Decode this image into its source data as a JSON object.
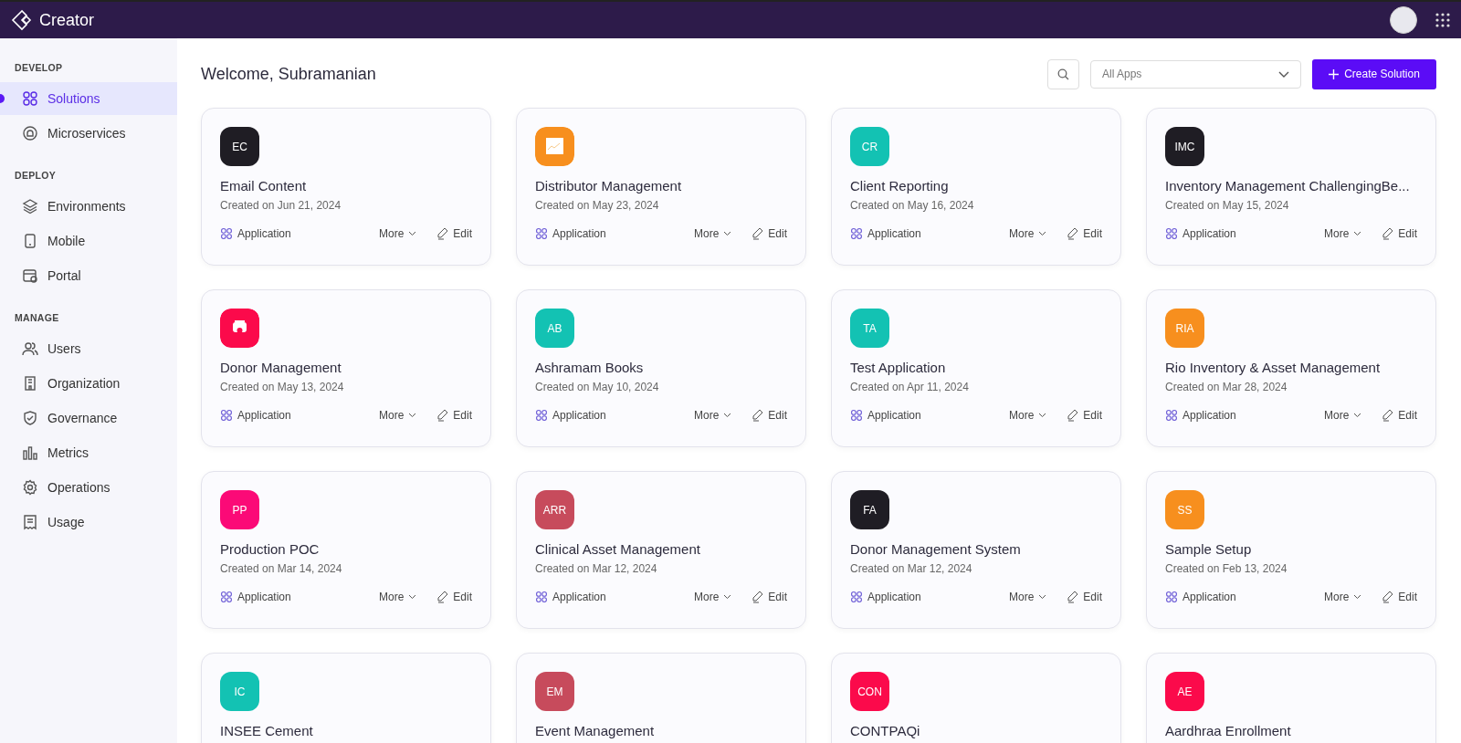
{
  "app": {
    "name": "Creator"
  },
  "sidebar": {
    "sections": [
      {
        "heading": "DEVELOP",
        "items": [
          {
            "label": "Solutions",
            "kind": "grid",
            "selected": true
          },
          {
            "label": "Microservices",
            "kind": "service",
            "selected": false
          }
        ]
      },
      {
        "heading": "DEPLOY",
        "items": [
          {
            "label": "Environments",
            "kind": "layers",
            "selected": false
          },
          {
            "label": "Mobile",
            "kind": "mobile",
            "selected": false
          },
          {
            "label": "Portal",
            "kind": "portal",
            "selected": false
          }
        ]
      },
      {
        "heading": "MANAGE",
        "items": [
          {
            "label": "Users",
            "kind": "users",
            "selected": false
          },
          {
            "label": "Organization",
            "kind": "building",
            "selected": false
          },
          {
            "label": "Governance",
            "kind": "shield",
            "selected": false
          },
          {
            "label": "Metrics",
            "kind": "bars",
            "selected": false
          },
          {
            "label": "Operations",
            "kind": "gear",
            "selected": false
          },
          {
            "label": "Usage",
            "kind": "receipt",
            "selected": false
          }
        ]
      }
    ]
  },
  "header": {
    "welcome": "Welcome, Subramanian",
    "filter": {
      "value": "All Apps"
    },
    "create_button": "Create Solution"
  },
  "cards": [
    {
      "kind": "initials",
      "badge": "EC",
      "color": "#1f1d24",
      "title": "Email Content",
      "date": "Created on Jun 21, 2024",
      "type": "Application",
      "more": "More",
      "edit": "Edit"
    },
    {
      "kind": "chart",
      "color": "#f78f1e",
      "title": "Distributor Management",
      "date": "Created on May 23, 2024",
      "type": "Application",
      "more": "More",
      "edit": "Edit"
    },
    {
      "kind": "initials",
      "badge": "CR",
      "color": "#13c2b3",
      "title": "Client Reporting",
      "date": "Created on May 16, 2024",
      "type": "Application",
      "more": "More",
      "edit": "Edit"
    },
    {
      "kind": "initials",
      "badge": "IMC",
      "color": "#1f1d24",
      "title": "Inventory Management ChallengingBe...",
      "date": "Created on May 15, 2024",
      "type": "Application",
      "more": "More",
      "edit": "Edit"
    },
    {
      "kind": "robot",
      "color": "#fb0a4b",
      "title": "Donor Management",
      "date": "Created on May 13, 2024",
      "type": "Application",
      "more": "More",
      "edit": "Edit"
    },
    {
      "kind": "initials",
      "badge": "AB",
      "color": "#13c2b3",
      "title": "Ashramam Books",
      "date": "Created on May 10, 2024",
      "type": "Application",
      "more": "More",
      "edit": "Edit"
    },
    {
      "kind": "initials",
      "badge": "TA",
      "color": "#13c2b3",
      "title": "Test Application",
      "date": "Created on Apr 11, 2024",
      "type": "Application",
      "more": "More",
      "edit": "Edit"
    },
    {
      "kind": "initials",
      "badge": "RIA",
      "color": "#f78f1e",
      "title": "Rio Inventory & Asset Management",
      "date": "Created on Mar 28, 2024",
      "type": "Application",
      "more": "More",
      "edit": "Edit"
    },
    {
      "kind": "initials",
      "badge": "PP",
      "color": "#fb0a77",
      "title": "Production POC",
      "date": "Created on Mar 14, 2024",
      "type": "Application",
      "more": "More",
      "edit": "Edit"
    },
    {
      "kind": "initials",
      "badge": "ARR",
      "color": "#c74b5c",
      "title": "Clinical Asset Management",
      "date": "Created on Mar 12, 2024",
      "type": "Application",
      "more": "More",
      "edit": "Edit"
    },
    {
      "kind": "initials",
      "badge": "FA",
      "color": "#1f1d24",
      "title": "Donor Management System",
      "date": "Created on Mar 12, 2024",
      "type": "Application",
      "more": "More",
      "edit": "Edit"
    },
    {
      "kind": "initials",
      "badge": "SS",
      "color": "#f78f1e",
      "title": "Sample Setup",
      "date": "Created on Feb 13, 2024",
      "type": "Application",
      "more": "More",
      "edit": "Edit"
    },
    {
      "kind": "initials",
      "badge": "IC",
      "color": "#13c2b3",
      "title": "INSEE Cement"
    },
    {
      "kind": "initials",
      "badge": "EM",
      "color": "#c74b5c",
      "title": "Event Management"
    },
    {
      "kind": "initials",
      "badge": "CON",
      "color": "#fb0a4b",
      "title": "CONTPAQi"
    },
    {
      "kind": "initials",
      "badge": "AE",
      "color": "#fb0a4b",
      "title": "Aardhraa Enrollment"
    }
  ]
}
